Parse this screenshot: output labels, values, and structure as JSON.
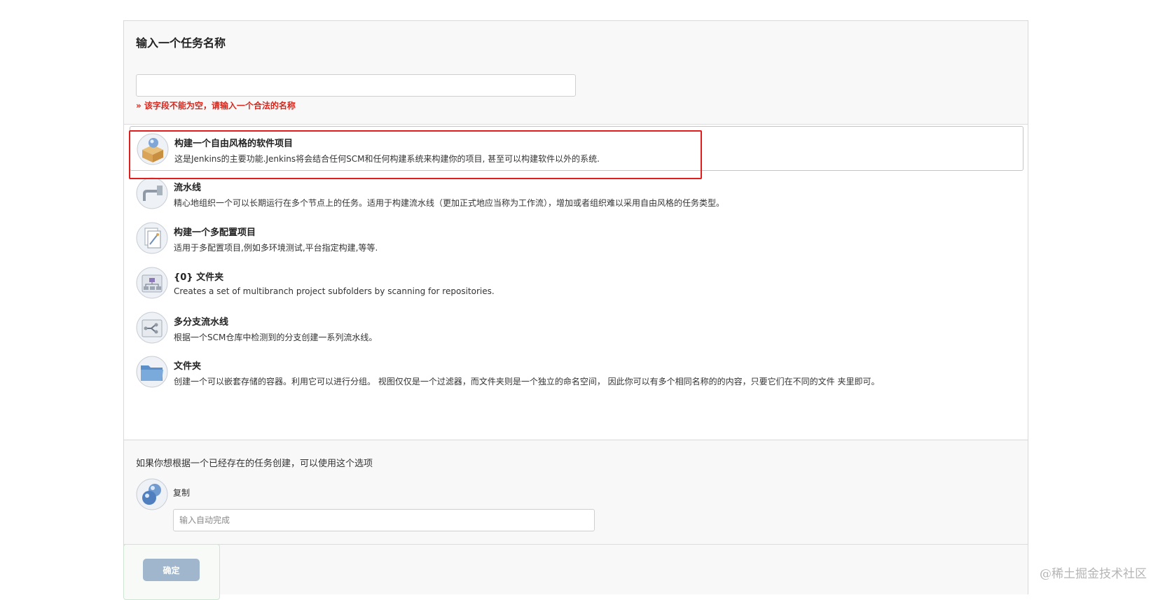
{
  "form": {
    "title": "输入一个任务名称",
    "name_value": "",
    "validation_message": "» 该字段不能为空，请输入一个合法的名称"
  },
  "item_types": [
    {
      "title": "构建一个自由风格的软件项目",
      "desc": "这是Jenkins的主要功能.Jenkins将会结合任何SCM和任何构建系统来构建你的项目, 甚至可以构建软件以外的系统.",
      "icon": "freestyle-box-icon",
      "selected": true
    },
    {
      "title": "流水线",
      "desc": "精心地组织一个可以长期运行在多个节点上的任务。适用于构建流水线（更加正式地应当称为工作流），增加或者组织难以采用自由风格的任务类型。",
      "icon": "pipeline-icon"
    },
    {
      "title": "构建一个多配置项目",
      "desc": "适用于多配置项目,例如多环境测试,平台指定构建,等等.",
      "icon": "multi-config-icon"
    },
    {
      "title": "{0} 文件夹",
      "desc": "Creates a set of multibranch project subfolders by scanning for repositories.",
      "icon": "organization-folder-icon"
    },
    {
      "title": "多分支流水线",
      "desc": "根据一个SCM仓库中检测到的分支创建一系列流水线。",
      "icon": "multibranch-pipeline-icon"
    },
    {
      "title": "文件夹",
      "desc": "创建一个可以嵌套存储的容器。利用它可以进行分组。 视图仅仅是一个过滤器，而文件夹则是一个独立的命名空间， 因此你可以有多个相同名称的的内容，只要它们在不同的文件 夹里即可。",
      "icon": "folder-icon"
    }
  ],
  "copy": {
    "hint": "如果你想根据一个已经存在的任务创建，可以使用这个选项",
    "label": "复制",
    "placeholder": "输入自动完成",
    "icon": "copy-spheres-icon"
  },
  "footer": {
    "ok_label": "确定"
  },
  "watermark": "@稀土掘金技术社区",
  "colors": {
    "error": "#d9261c",
    "highlight": "#e01e1e",
    "ok_button": "#9fb6cc"
  }
}
